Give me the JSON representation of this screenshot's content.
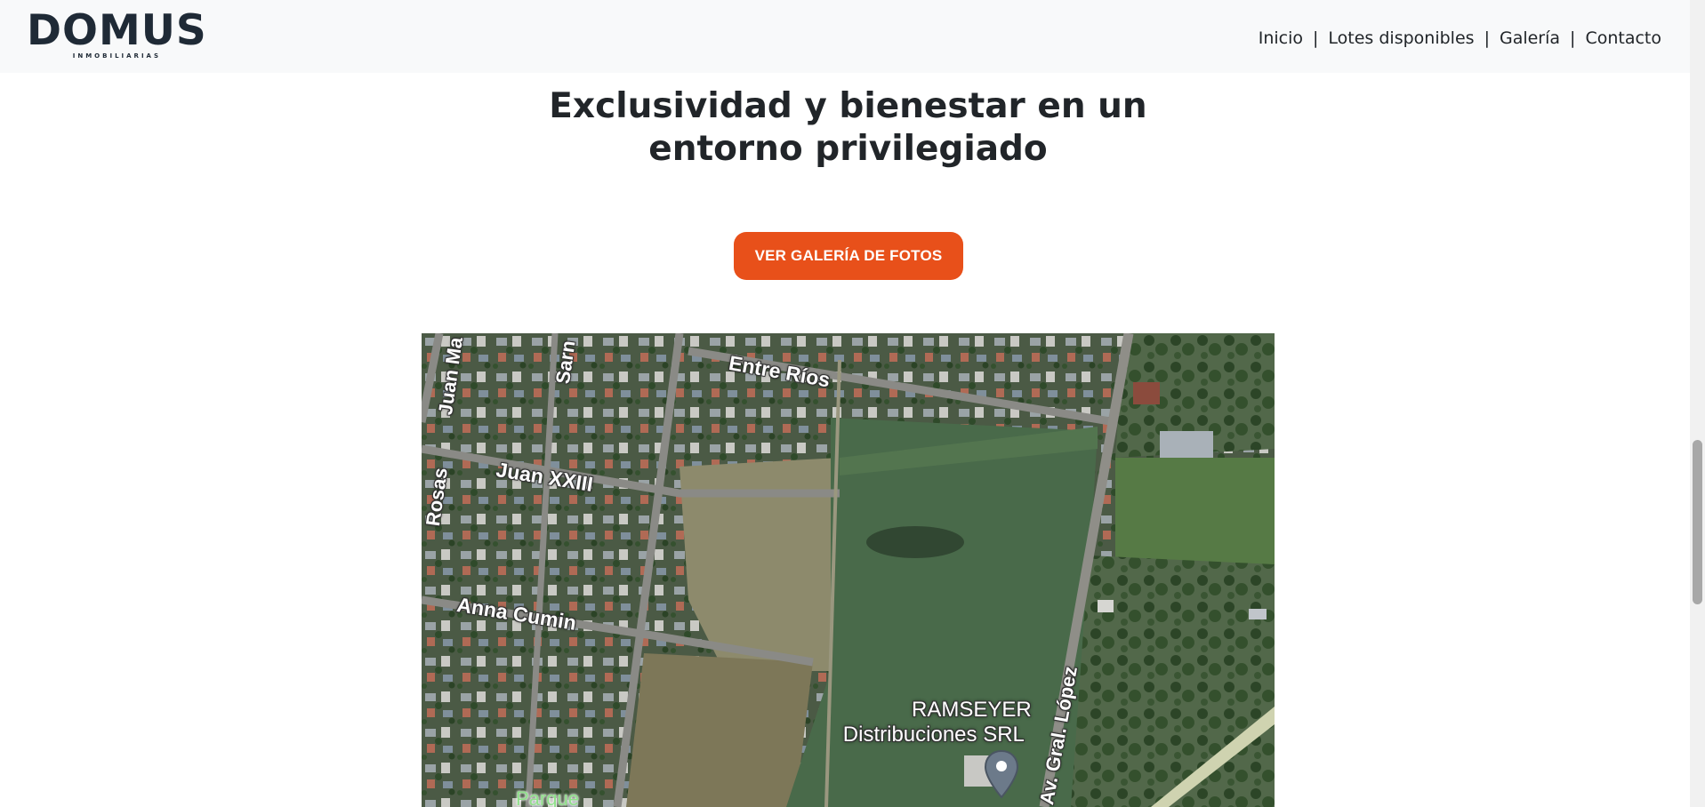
{
  "header": {
    "brand_name": "DOMUS",
    "brand_tagline": "INMOBILIARIAS",
    "nav": [
      {
        "label": "Inicio"
      },
      {
        "label": "Lotes disponibles"
      },
      {
        "label": "Galería"
      },
      {
        "label": "Contacto"
      }
    ],
    "separator": "|"
  },
  "hero": {
    "title_line1": "Exclusividad y bienestar en un",
    "title_line2": "entorno privilegiado",
    "cta_label": "VER GALERÍA DE FOTOS"
  },
  "map": {
    "streets": {
      "juan_manuel": "Juan Ma",
      "sarmiento": "Sarn",
      "entre_rios": "Entre Ríos",
      "juan_xxiii": "Juan XXIII",
      "rosas": "Rosas",
      "anna_cumin": "Anna Cumin",
      "gral_lopez": "Av. Gral. López"
    },
    "place": {
      "line1": "RAMSEYER",
      "line2": "Distribuciones SRL"
    },
    "park": "Parque",
    "pin_icon": "map-pin-icon"
  },
  "colors": {
    "accent": "#e8501a",
    "header_bg": "#f8f9fa",
    "text": "#212529"
  }
}
